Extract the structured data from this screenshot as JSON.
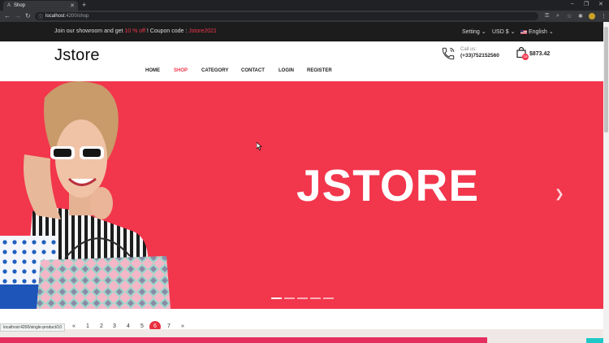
{
  "browser": {
    "tab_title": "Shop",
    "tab_favicon": "A",
    "url_host": "localhost",
    "url_path": ":4200/shop",
    "avatar_letter": ""
  },
  "topbar": {
    "promo_before": "Join our showroom and get ",
    "promo_discount": "10 % off",
    "promo_middle": " ! Coupon code : ",
    "promo_code": "Jstore2021",
    "setting_label": "Setting",
    "currency_label": "USD $",
    "language_label": "English"
  },
  "header": {
    "logo": "Jstore",
    "nav": [
      "HOME",
      "SHOP",
      "CATEGORY",
      "CONTACT",
      "LOGIN",
      "REGISTER"
    ],
    "active_nav": "SHOP",
    "call_label": "Call us:",
    "call_number": "(+33)752152560",
    "cart_count": "16",
    "cart_total": "$873.42"
  },
  "hero": {
    "brand_text": "JSTORE",
    "slide_count": 5,
    "active_slide": 0
  },
  "pagination": {
    "prev": "«",
    "pages": [
      "1",
      "2",
      "3",
      "4",
      "5",
      "6",
      "7"
    ],
    "active_page": "6",
    "next": "»"
  },
  "status_url": "localhost:4200/single-product/10",
  "colors": {
    "accent": "#f2364c",
    "topbar_bg": "#1c1c1c",
    "hero_bg": "#f2364c"
  },
  "icons": {
    "phone": "phone-icon",
    "cart": "shopping-bag-icon",
    "flag": "us-flag-icon",
    "next": "chevron-right-icon"
  }
}
